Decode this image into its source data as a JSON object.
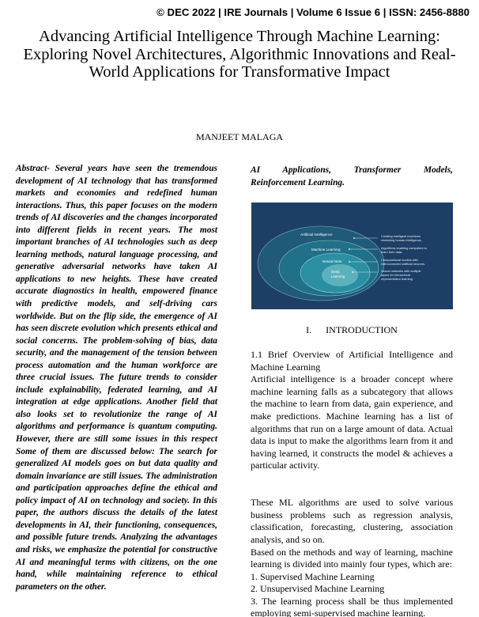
{
  "header": {
    "journal_line": "© DEC 2022 | IRE Journals | Volume 6 Issue 6 | ISSN: 2456-8880"
  },
  "paper": {
    "title": "Advancing Artificial Intelligence Through Machine Learning: Exploring Novel Architectures, Algorithmic Innovations and Real-World Applications for Transformative Impact",
    "author": "MANJEET MALAGA"
  },
  "abstract": {
    "text": "Abstract- Several years have seen the tremendous development of AI technology that has transformed markets and economies and redefined human interactions. Thus, this paper focuses on the modern trends of AI discoveries and the changes incorporated into different fields in recent years. The most important branches of AI technologies such as deep learning methods, natural language processing, and generative adversarial networks have taken AI applications to new heights. These have created accurate diagnostics in health, empowered finance with predictive models, and self-driving cars worldwide. But on the flip side, the emergence of AI has seen discrete evolution which presents ethical and social concerns. The problem-solving of bias, data security, and the management of the tension between process automation and the human workforce are three crucial issues. The future trends to consider include explainability, federated learning, and AI integration at edge applications. Another field that also looks set to revolutionize the range of AI algorithms and performance is quantum computing. However, there are still some issues in this respect Some of them are discussed below: The search for generalized AI models goes on but data quality and domain invariance are still issues. The administration and participation approaches define the ethical and policy impact of AI on technology and society. In this paper, the authors discuss the details of the latest developments in AI, their functioning, consequences, and possible future trends. Analyzing the advantages and risks, we emphasize the potential for constructive AI and meaningful terms with citizens, on the one hand, while maintaining reference to ethical parameters on the other."
  },
  "keywords": {
    "line1": "AI Applications, Transformer Models,",
    "line2": "Reinforcement Learning."
  },
  "figure": {
    "colors": {
      "background": "#1d3f66",
      "ring_outer": "#1f5a78",
      "ring_ml": "#1f7088",
      "ring_nn": "#2a8fa3",
      "ring_dl": "#5bb2bd",
      "text": "#ffffff"
    },
    "layers": [
      {
        "label": "Artificial Intelligence",
        "description_line1": "Creating intelligent machines",
        "description_line2": "mimicking human intelligence.",
        "description_line3": ""
      },
      {
        "label": "Machine Learning",
        "description_line1": "Algorithms enabling computers to",
        "description_line2": "learn from data.",
        "description_line3": ""
      },
      {
        "label": "Neural Nets",
        "description_line1": "Computational models with",
        "description_line2": "interconnected artificial neurons.",
        "description_line3": ""
      },
      {
        "label_line1": "Deep",
        "label_line2": "Learning",
        "description_line1": "Neural networks with multiple",
        "description_line2": "layers for hierarchical",
        "description_line3": "representation learning."
      }
    ]
  },
  "introduction": {
    "section_number": "I.",
    "section_title": "INTRODUCTION",
    "subsection_title": "1.1 Brief Overview of Artificial Intelligence and Machine Learning",
    "paragraph1": "Artificial intelligence is a broader concept where machine learning falls as a subcategory that allows the machine to learn from data, gain experience, and make predictions. Machine learning has a list of algorithms that run on a large amount of data. Actual data is input to make the algorithms learn from it and having learned, it constructs the model & achieves a particular activity.",
    "paragraph2": "These ML algorithms are used to solve various business problems such as regression analysis, classification, forecasting, clustering, association analysis, and so on.",
    "paragraph3": "Based on the methods and way of learning, machine learning is divided into mainly four types, which are:",
    "list": [
      "1. Supervised Machine Learning",
      "2. Unsupervised Machine Learning",
      "3. The learning process shall be thus implemented employing semi-supervised machine learning."
    ]
  }
}
